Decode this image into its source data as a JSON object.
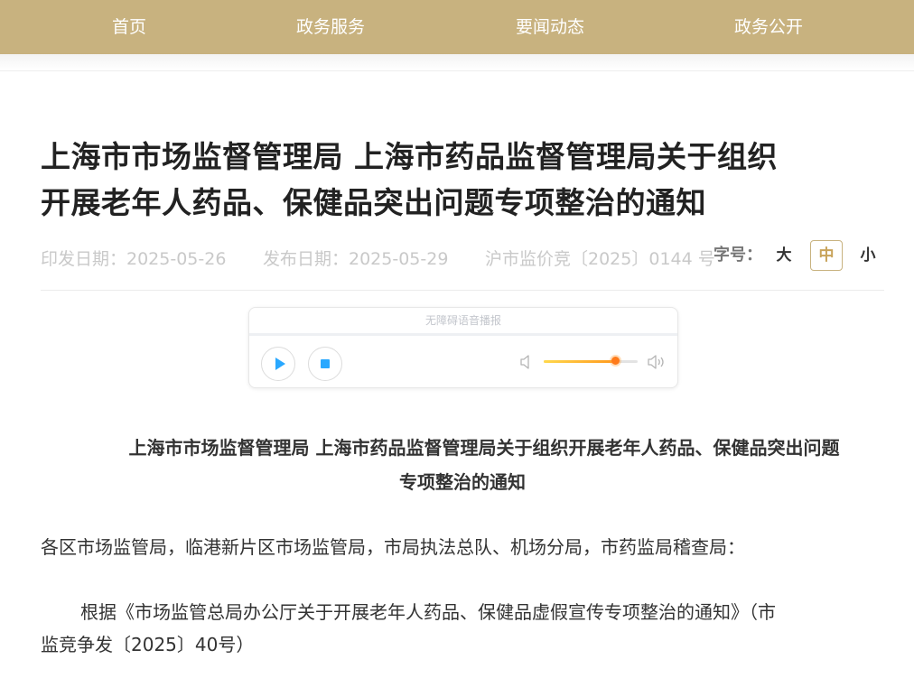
{
  "nav": {
    "items": [
      "首页",
      "政务服务",
      "要闻动态",
      "政务公开"
    ]
  },
  "article": {
    "title_line1": "上海市市场监督管理局 上海市药品监督管理局关于组织",
    "title_line2": "开展老年人药品、保健品突出问题专项整治的通知",
    "issue_date": "印发日期：2025-05-26",
    "publish_date": "发布日期：2025-05-29",
    "doc_number": "沪市监价竞〔2025〕0144 号",
    "font_size_label": "字号：",
    "font_sizes": [
      "大",
      "中",
      "小"
    ],
    "font_size_selected": "中"
  },
  "player": {
    "title": "无障碍语音播报",
    "volume_level": 0.76,
    "accent_color": "#29a8ff"
  },
  "body": {
    "heading_line1": "上海市市场监督管理局 上海市药品监督管理局关于组织开展老年人药品、保健品突出问题",
    "heading_line2": "专项整治的通知",
    "salutation": "各区市场监管局，临港新片区市场监管局，市局执法总队、机场分局，市药监局稽查局：",
    "para1_line1": "根据《市场监管总局办公厅关于开展老年人药品、保健品虚假宣传专项整治的通知》（市",
    "para1_line2": "监竞争发〔2025〕40号）"
  },
  "colors": {
    "nav_bg": "#c8b27f",
    "selected_fs": "#c8a35a"
  }
}
